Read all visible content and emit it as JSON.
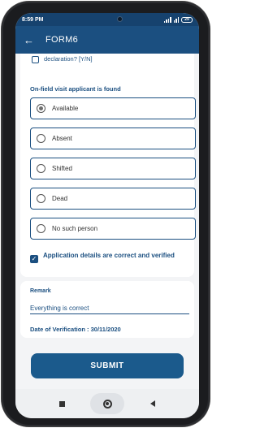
{
  "status_bar": {
    "time": "8:59 PM",
    "battery": "29"
  },
  "app_bar": {
    "back_icon": "arrow-left-icon",
    "title": "FORM6"
  },
  "form": {
    "declaration_label": "declaration? [Y/N]",
    "declaration_checked": false,
    "onfield_label": "On-field visit applicant is found",
    "options": [
      {
        "label": "Available",
        "selected": true
      },
      {
        "label": "Absent",
        "selected": false
      },
      {
        "label": "Shifted",
        "selected": false
      },
      {
        "label": "Dead",
        "selected": false
      },
      {
        "label": "No such person",
        "selected": false
      }
    ],
    "verify_label": "Application details are correct and verified",
    "verify_checked": true
  },
  "remark": {
    "label": "Remark",
    "value": "Everything is correct",
    "date_of_verification": "Date of Verification : 30/11/2020"
  },
  "submit_label": "SUBMIT",
  "nav_bar": {
    "recents_icon": "square-icon",
    "home_icon": "circle-home-icon",
    "back_icon": "triangle-back-icon"
  },
  "colors": {
    "primary": "#1b4f80",
    "status_bar": "#16426e",
    "background": "#f3f4f6"
  }
}
